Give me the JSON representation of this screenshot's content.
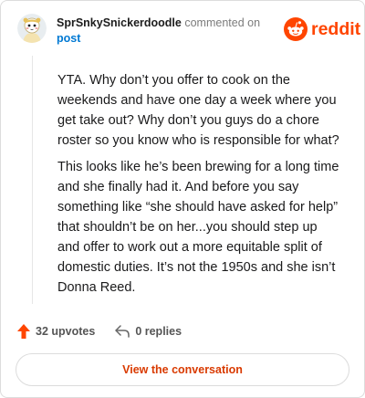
{
  "comment": {
    "username": "SprSnkySnickerdoodle",
    "action": "commented on",
    "target": "post",
    "paragraphs": [
      "YTA. Why don’t you offer to cook on the weekends and have one day a week where you get take out? Why don’t you guys do a chore roster so you know who is responsible for what?",
      "This looks like he’s been brewing for a long time and she finally had it. And before you say something like “she should have asked for help” that shouldn’t be on her...you should step up and offer to work out a more equitable split of domestic duties. It’s not the 1950s and she isn’t Donna Reed."
    ]
  },
  "brand": {
    "name": "reddit",
    "color": "#ff4500"
  },
  "stats": {
    "upvotes": "32 upvotes",
    "replies": "0 replies"
  },
  "actions": {
    "view_conversation": "View the conversation"
  },
  "icons": {
    "avatar": "snoo-avatar-icon",
    "logo": "reddit-alien-icon",
    "upvote": "upvote-arrow-icon",
    "reply": "reply-arrow-icon"
  },
  "colors": {
    "accent": "#ff4500",
    "link": "#0079d3",
    "button_text": "#d93a00"
  }
}
